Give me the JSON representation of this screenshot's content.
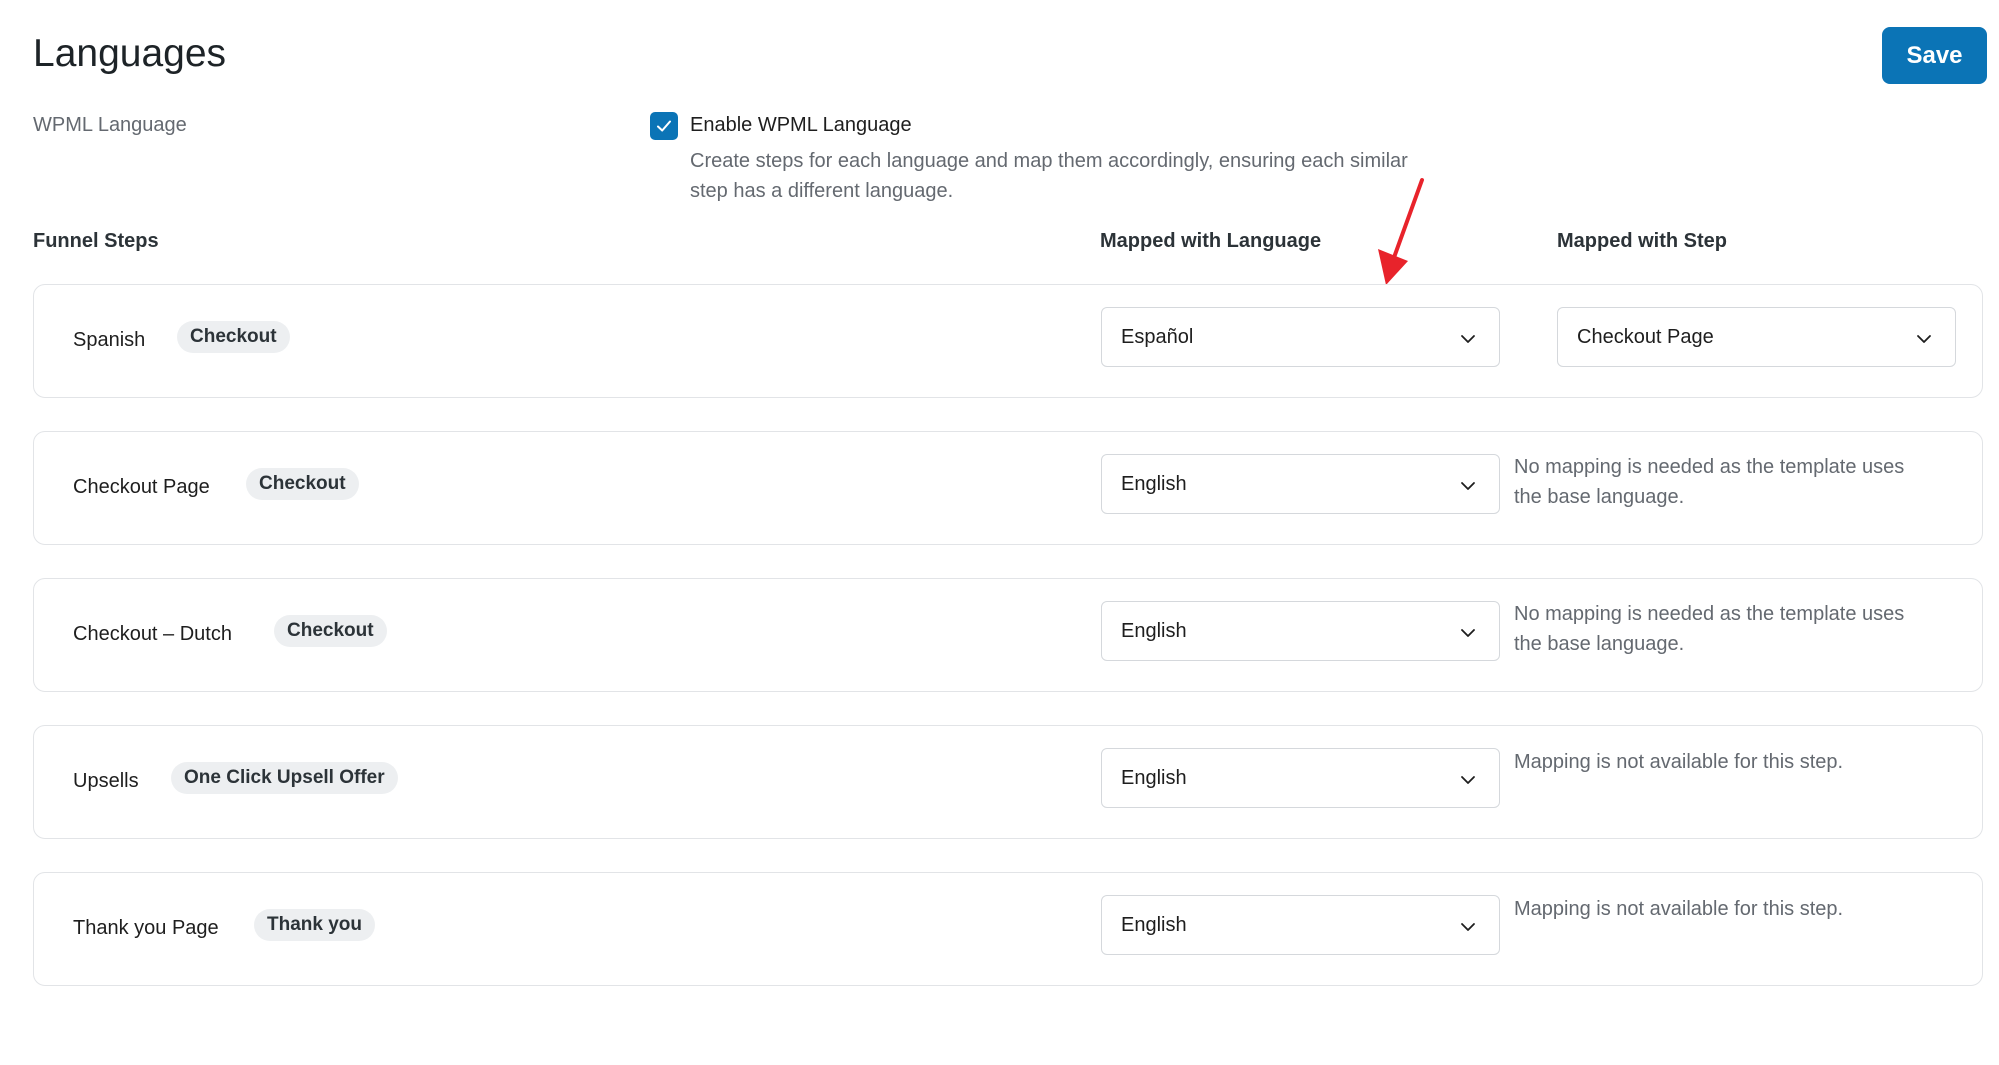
{
  "page": {
    "title": "Languages",
    "save_label": "Save"
  },
  "wpml": {
    "label": "WPML Language",
    "checkbox_label": "Enable WPML Language",
    "checked": true,
    "description": "Create steps for each language and map them accordingly, ensuring each similar step has a different language."
  },
  "columns": {
    "steps": "Funnel Steps",
    "language": "Mapped with Language",
    "step": "Mapped with Step"
  },
  "rows": [
    {
      "name": "Spanish",
      "badge": "Checkout",
      "language": "Español",
      "step_select": "Checkout Page",
      "note": ""
    },
    {
      "name": "Checkout Page",
      "badge": "Checkout",
      "language": "English",
      "step_select": "",
      "note": "No mapping is needed as the template uses the base language."
    },
    {
      "name": "Checkout – Dutch",
      "badge": "Checkout",
      "language": "English",
      "step_select": "",
      "note": "No mapping is needed as the template uses the base language."
    },
    {
      "name": "Upsells",
      "badge": "One Click Upsell Offer",
      "language": "English",
      "step_select": "",
      "note": "Mapping is not available for this step."
    },
    {
      "name": "Thank you Page",
      "badge": "Thank you",
      "language": "English",
      "step_select": "",
      "note": "Mapping is not available for this step."
    }
  ],
  "icons": {
    "checkbox": "checkmark-icon",
    "select": "chevron-down-icon",
    "annotation": "red-arrow-icon"
  },
  "colors": {
    "accent": "#0b74b6",
    "annotation": "#e8232b",
    "muted_text": "#646970",
    "badge_bg": "#edeff1"
  }
}
